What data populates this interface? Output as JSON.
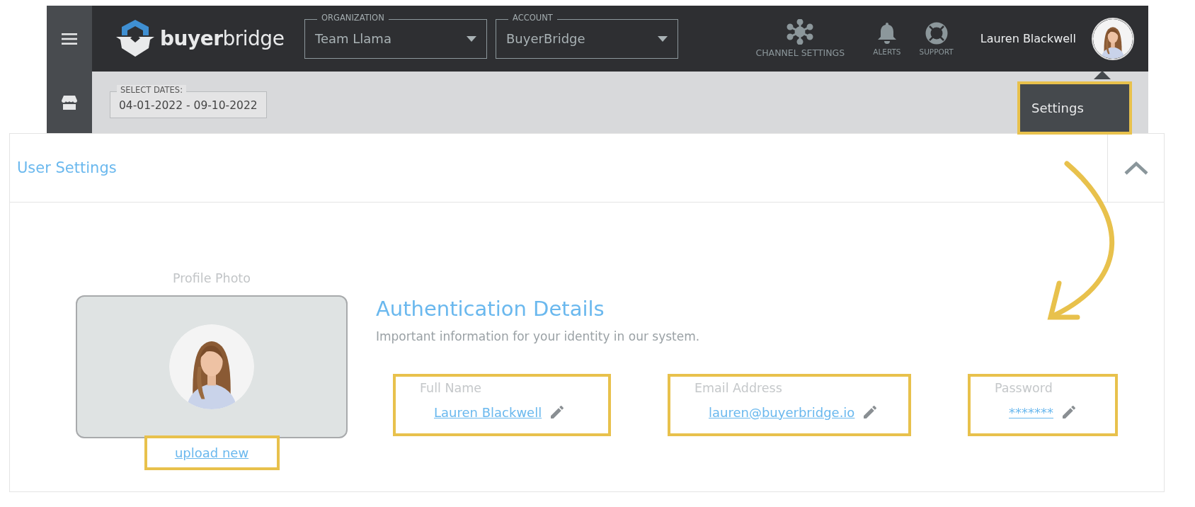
{
  "sidebar": {
    "items": [
      {
        "kind": "menu"
      },
      {
        "kind": "store"
      }
    ]
  },
  "topbar": {
    "logo": "**buyer**bridge",
    "selectors": [
      {
        "label": "ORGANIZATION",
        "value": "Team Llama"
      },
      {
        "label": "ACCOUNT",
        "value": "BuyerBridge"
      }
    ],
    "nav": [
      {
        "kind": "channels",
        "label": "CHANNEL SETTINGS"
      },
      {
        "kind": "alerts",
        "label": "ALERTS"
      },
      {
        "kind": "support",
        "label": "SUPPORT"
      }
    ],
    "user_name": "Lauren Blackwell"
  },
  "date_filter": {
    "label": "SELECT DATES:",
    "value": "04-01-2022 - 09-10-2022"
  },
  "user_menu": {
    "items": [
      {
        "label": "Settings",
        "highlighted": true
      }
    ]
  },
  "panel": {
    "title": "User Settings",
    "expanded": true,
    "profile_photo": {
      "label": "Profile Photo",
      "action": "upload new",
      "highlighted": true
    },
    "auth": {
      "title": "Authentication Details",
      "subtitle": "Important information for your identity in our system.",
      "fields": [
        {
          "label": "Full Name",
          "value": "Lauren Blackwell",
          "highlighted": true
        },
        {
          "label": "Email Address",
          "value": "lauren@buyerbridge.io",
          "highlighted": true
        },
        {
          "label": "Password",
          "value": "*******",
          "highlighted": true
        }
      ]
    }
  }
}
